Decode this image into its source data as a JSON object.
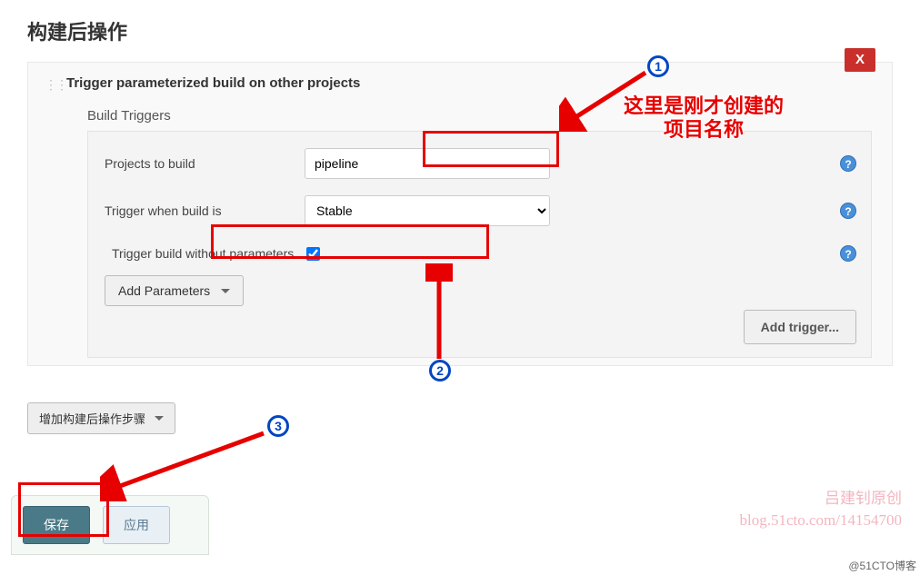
{
  "section": {
    "title": "构建后操作"
  },
  "block": {
    "title": "Trigger parameterized build on other projects",
    "delete_label": "X",
    "build_triggers_label": "Build Triggers",
    "projects_to_build": {
      "label": "Projects to build",
      "value": "pipeline"
    },
    "trigger_when": {
      "label": "Trigger when build is",
      "value": "Stable"
    },
    "trigger_no_params": {
      "label": "Trigger build without parameters",
      "checked": true
    },
    "add_params_label": "Add Parameters",
    "add_trigger_label": "Add trigger...",
    "help_glyph": "?"
  },
  "add_step_label": "增加构建后操作步骤",
  "footer": {
    "save_label": "保存",
    "apply_label": "应用"
  },
  "annotations": {
    "text1_line1": "这里是刚才创建的",
    "text1_line2": "项目名称",
    "badge1": "1",
    "badge2": "2",
    "badge3": "3"
  },
  "watermark": {
    "line1": "吕建钊原创",
    "line2": "blog.51cto.com/14154700",
    "corner": "@51CTO博客"
  }
}
